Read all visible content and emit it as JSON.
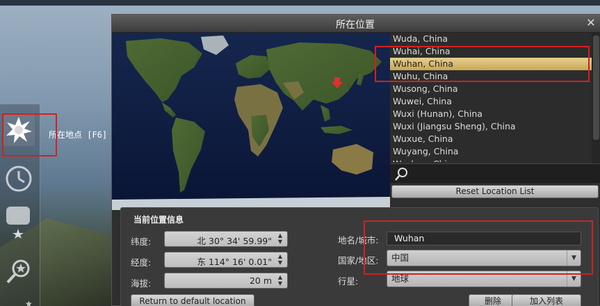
{
  "toolbar": {
    "location_label": "所在地点 [F6]",
    "icons": [
      "location-sun-icon",
      "clock-icon",
      "sky-viewing-icon",
      "search-star-icon"
    ]
  },
  "dialog": {
    "title": "所在位置",
    "close_symbol": "✕",
    "city_list": [
      "Wuda, China",
      "Wuhai, China",
      "Wuhan, China",
      "Wuhu, China",
      "Wusong, China",
      "Wuwei, China",
      "Wuxi (Hunan), China",
      "Wuxi (Jiangsu Sheng), China",
      "Wuxue, China",
      "Wuyang, China",
      "Wuzhou, China"
    ],
    "selected_city": "Wuhan, China",
    "search_value": "",
    "reset_label": "Reset Location List"
  },
  "info": {
    "section_title": "当前位置信息",
    "latitude_label": "纬度:",
    "latitude_value": "北 30° 34' 59.99\"",
    "longitude_label": "经度:",
    "longitude_value": "东 114° 16' 0.01\"",
    "altitude_label": "海拔:",
    "altitude_value": "20 m",
    "city_label": "地名/城市:",
    "city_value": "Wuhan",
    "country_label": "国家/地区:",
    "country_value": "中国",
    "planet_label": "行星:",
    "planet_value": "地球",
    "return_default_label": "Return to default location",
    "delete_label": "删除",
    "add_label": "加入列表"
  },
  "colors": {
    "highlight_box": "#d61f1f",
    "selected_row": "#d9bd6e",
    "ocean": "#0d1a3e",
    "marker": "#e03030"
  }
}
